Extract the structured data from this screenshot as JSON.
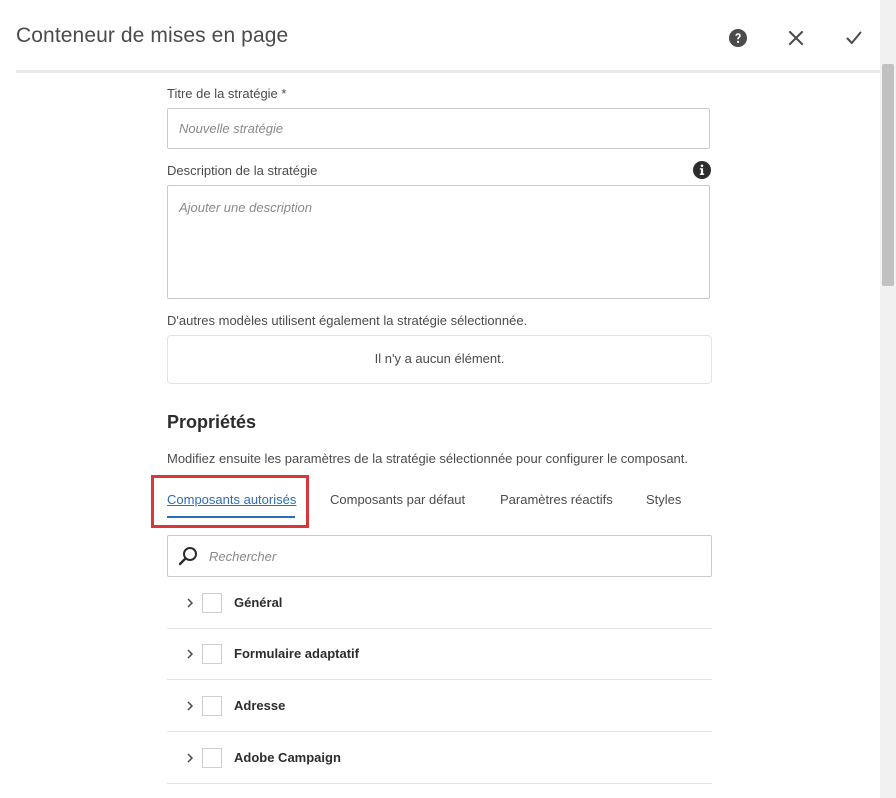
{
  "dialog": {
    "title": "Conteneur de mises en page"
  },
  "header_actions": {
    "help_icon": "help-circle-icon",
    "close_icon": "close-icon",
    "done_icon": "checkmark-icon"
  },
  "form": {
    "policy_title_label": "Titre de la stratégie *",
    "policy_title_placeholder": "Nouvelle stratégie",
    "policy_description_label": "Description de la stratégie",
    "policy_description_placeholder": "Ajouter une description",
    "other_templates_label": "D'autres modèles utilisent également la stratégie sélectionnée.",
    "other_templates_empty": "Il n'y a aucun élément."
  },
  "properties": {
    "title": "Propriétés",
    "description": "Modifiez ensuite les paramètres de la stratégie sélectionnée pour configurer le composant.",
    "tabs": [
      {
        "label": "Composants autorisés",
        "active": true
      },
      {
        "label": "Composants par défaut",
        "active": false
      },
      {
        "label": "Paramètres réactifs",
        "active": false
      },
      {
        "label": "Styles",
        "active": false
      }
    ],
    "search_placeholder": "Rechercher",
    "groups": [
      {
        "label": "Général"
      },
      {
        "label": "Formulaire adaptatif"
      },
      {
        "label": "Adresse"
      },
      {
        "label": "Adobe Campaign"
      }
    ]
  },
  "colors": {
    "accent": "#2d6cb8",
    "highlight": "#d9373a"
  }
}
